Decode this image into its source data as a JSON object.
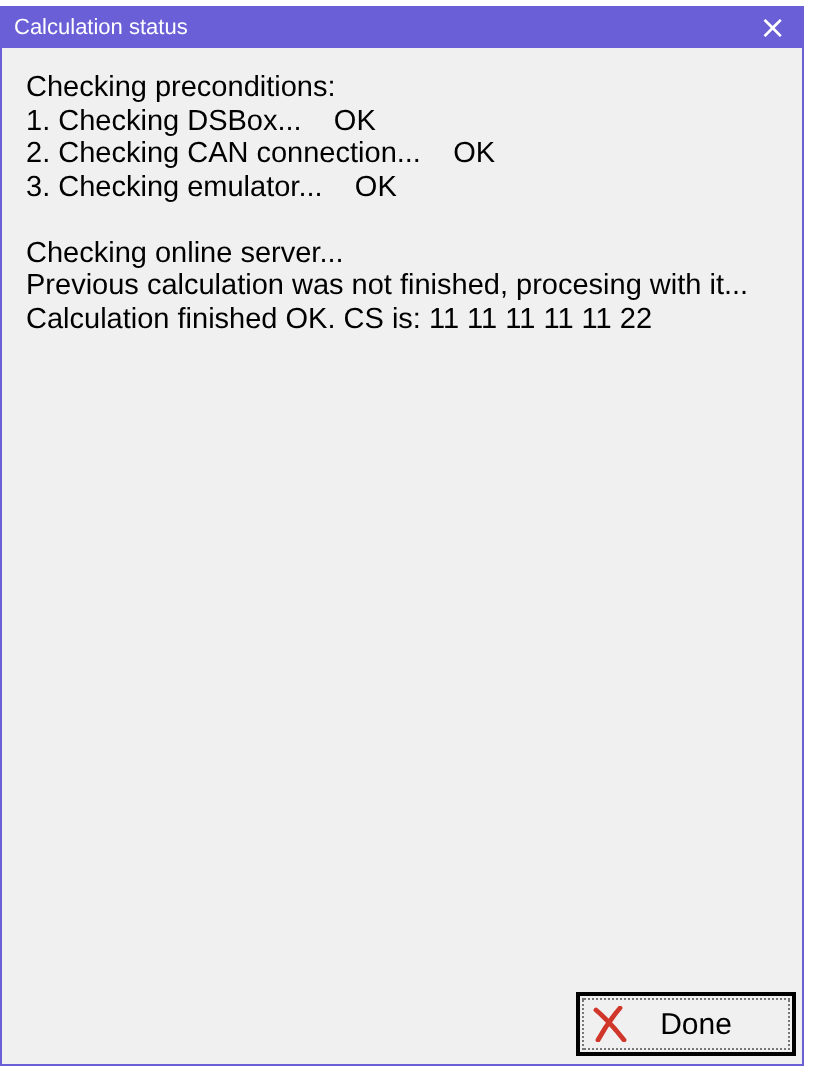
{
  "window": {
    "title": "Calculation status",
    "close": "×"
  },
  "log": [
    {
      "kind": "line",
      "text": "Checking preconditions:"
    },
    {
      "kind": "line",
      "text": "1. Checking DSBox...    OK"
    },
    {
      "kind": "line",
      "text": "2. Checking CAN connection...    OK"
    },
    {
      "kind": "line",
      "text": "3. Checking emulator...    OK"
    },
    {
      "kind": "blank"
    },
    {
      "kind": "line",
      "text": "Checking online server..."
    },
    {
      "kind": "line",
      "text": "Previous calculation was not finished, procesing with it..."
    },
    {
      "kind": "line",
      "text": "Calculation finished OK. CS is: 11 11 11 11 11 22"
    }
  ],
  "buttons": [
    {
      "label": "Done"
    }
  ]
}
